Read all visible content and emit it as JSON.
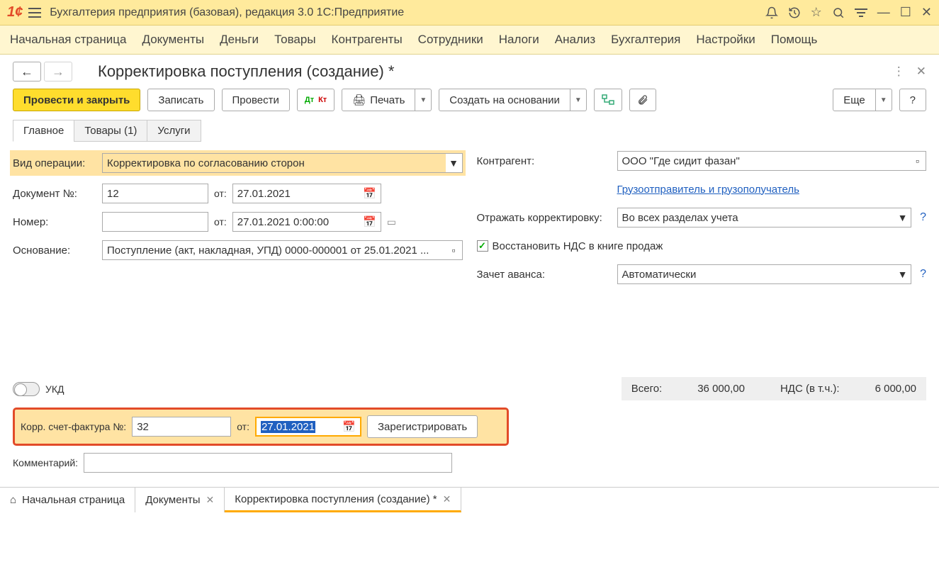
{
  "app_title": "Бухгалтерия предприятия (базовая), редакция 3.0 1С:Предприятие",
  "main_menu": [
    "Начальная страница",
    "Документы",
    "Деньги",
    "Товары",
    "Контрагенты",
    "Сотрудники",
    "Налоги",
    "Анализ",
    "Бухгалтерия",
    "Настройки",
    "Помощь"
  ],
  "page_title": "Корректировка поступления (создание) *",
  "toolbar": {
    "post_close": "Провести и закрыть",
    "save": "Записать",
    "post": "Провести",
    "print": "Печать",
    "create_based": "Создать на основании",
    "more": "Еще",
    "help": "?"
  },
  "tabs": [
    "Главное",
    "Товары (1)",
    "Услуги"
  ],
  "left": {
    "op_type_label": "Вид операции:",
    "op_type_value": "Корректировка по согласованию сторон",
    "doc_no_label": "Документ №:",
    "doc_no_value": "12",
    "from_label": "от:",
    "doc_date": "27.01.2021",
    "number_label": "Номер:",
    "number_value": "",
    "number_date": "27.01.2021  0:00:00",
    "basis_label": "Основание:",
    "basis_value": "Поступление (акт, накладная, УПД) 0000-000001 от 25.01.2021 ..."
  },
  "right": {
    "contractor_label": "Контрагент:",
    "contractor_value": "ООО \"Где сидит фазан\"",
    "shipper_link": "Грузоотправитель и грузополучатель",
    "reflect_label": "Отражать корректировку:",
    "reflect_value": "Во всех разделах учета",
    "restore_vat": "Восстановить НДС в книге продаж",
    "advance_label": "Зачет аванса:",
    "advance_value": "Автоматически"
  },
  "ukd_label": "УКД",
  "totals": {
    "total_label": "Всего:",
    "total_value": "36 000,00",
    "vat_label": "НДС (в т.ч.):",
    "vat_value": "6 000,00"
  },
  "invoice": {
    "label": "Корр. счет-фактура №:",
    "number": "32",
    "from": "от:",
    "date": "27.01.2021",
    "register_btn": "Зарегистрировать"
  },
  "comment_label": "Комментарий:",
  "comment_value": "",
  "bottom_tabs": {
    "home": "Начальная страница",
    "docs": "Документы",
    "current": "Корректировка поступления (создание) *"
  }
}
